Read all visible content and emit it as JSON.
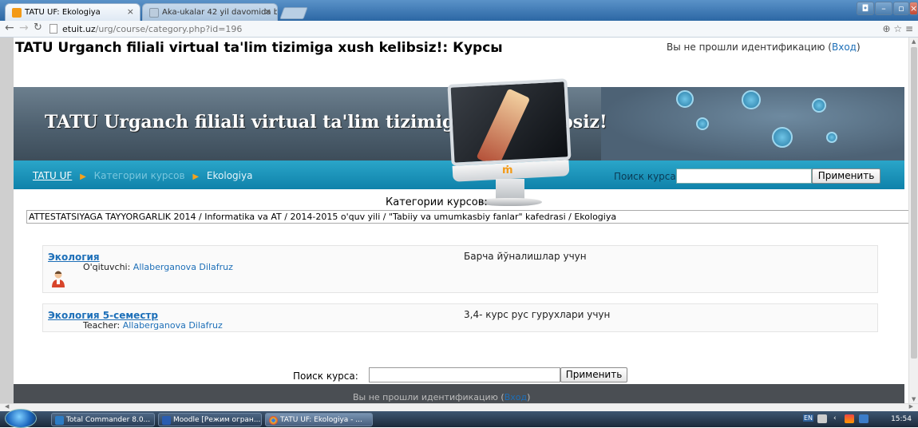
{
  "browser": {
    "tabs": [
      {
        "label": "TATU UF: Ekologiya",
        "active": true
      },
      {
        "label": "Aka-ukalar 42 yil davomida b",
        "active": false
      }
    ],
    "url_host": "etuit.uz",
    "url_path": "/urg/course/category.php?id=196"
  },
  "page": {
    "headline": "TATU Urganch filiali virtual ta'lim tizimiga xush kelibsiz!: Курсы",
    "login_prefix": "Вы не прошли идентификацию (",
    "login_link": "Вход",
    "login_suffix": ")",
    "banner_title": "TATU Urganch filiali virtual ta'lim tizimiga xush kelibsiz!",
    "breadcrumb": [
      "TATU UF",
      "Категории курсов",
      "Ekologiya"
    ],
    "search_label": "Поиск курса:",
    "search_button": "Применить",
    "categories_heading": "Категории курсов:",
    "category_path": "ATTESTATSIYAGA TAYYORGARLIK 2014 / Informatika va AT / 2014-2015 o'quv yili / \"Tabiiy va umumkasbiy fanlar\" kafedrasi / Ekologiya",
    "courses": [
      {
        "name": "Экология",
        "teacher_role": "O'qituvchi:",
        "teacher_name": "Allaberganova Dilafruz",
        "summary": "Барча йўналишлар учун"
      },
      {
        "name": "Экология 5-семестр",
        "teacher_role": "Teacher:",
        "teacher_name": "Allaberganova Dilafruz",
        "summary": "3,4- курс рус гурухлари учун"
      }
    ],
    "bottom_search_label": "Поиск курса:",
    "bottom_search_button": "Применить",
    "footer_prefix": "Вы не прошли идентификацию (",
    "footer_link": "Вход",
    "footer_suffix": ")"
  },
  "taskbar": {
    "items": [
      "Total Commander 8.0...",
      "Moodle [Режим огран...",
      "TATU UF: Ekologiya - ..."
    ],
    "lang": "EN",
    "clock": "15:54"
  },
  "colors": {
    "link": "#1d6fb8",
    "nav_strip": "#1a95bd",
    "breadcrumb_arrow": "#f5a21b"
  }
}
